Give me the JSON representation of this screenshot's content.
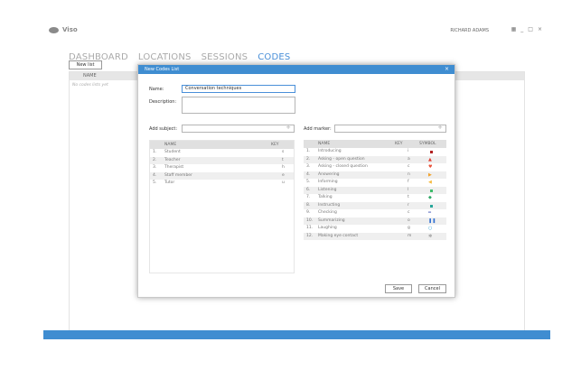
{
  "app": {
    "name": "Viso",
    "user": "RICHARD ADAMS",
    "window_controls": [
      "_",
      "□",
      "×"
    ]
  },
  "nav": {
    "tabs": [
      "DASHBOARD",
      "LOCATIONS",
      "SESSIONS",
      "CODES"
    ],
    "active": "CODES"
  },
  "toolbar": {
    "new_list": "New list"
  },
  "list": {
    "header": "NAME",
    "empty_text": "No codes lists yet"
  },
  "dialog": {
    "title": "New Codes List",
    "close": "×",
    "name_label": "Name:",
    "name_value": "Conversation techniques",
    "description_label": "Description:",
    "description_value": "",
    "add_subject_label": "Add subject:",
    "add_marker_label": "Add marker:",
    "add_symbol": "+",
    "subjects": {
      "headers": {
        "name": "NAME",
        "key": "KEY"
      },
      "rows": [
        {
          "num": "1.",
          "name": "Student",
          "key": "s"
        },
        {
          "num": "2.",
          "name": "Teacher",
          "key": "t"
        },
        {
          "num": "3.",
          "name": "Therapist",
          "key": "h"
        },
        {
          "num": "4.",
          "name": "Staff member",
          "key": "e"
        },
        {
          "num": "5.",
          "name": "Tutor",
          "key": "u"
        }
      ]
    },
    "markers": {
      "headers": {
        "name": "NAME",
        "key": "KEY",
        "symbol": "SYMBOL"
      },
      "rows": [
        {
          "num": "1.",
          "name": "Introducing",
          "key": "i",
          "symbol": "square",
          "color": "#b22222"
        },
        {
          "num": "2.",
          "name": "Asking - open question",
          "key": "a",
          "symbol": "triangle",
          "color": "#e23b2e"
        },
        {
          "num": "3.",
          "name": "Asking - closed question",
          "key": "c",
          "symbol": "heart",
          "color": "#e8533a"
        },
        {
          "num": "4.",
          "name": "Answering",
          "key": "n",
          "symbol": "arrow-right",
          "color": "#f2a22a"
        },
        {
          "num": "5.",
          "name": "Informing",
          "key": "f",
          "symbol": "arrow-left",
          "color": "#f5b93c"
        },
        {
          "num": "6.",
          "name": "Listening",
          "key": "l",
          "symbol": "square",
          "color": "#3dbb6a"
        },
        {
          "num": "7.",
          "name": "Talking",
          "key": "t",
          "symbol": "diamond",
          "color": "#2fa866"
        },
        {
          "num": "8.",
          "name": "Instructing",
          "key": "r",
          "symbol": "square",
          "color": "#26a69a"
        },
        {
          "num": "9.",
          "name": "Checking",
          "key": "c",
          "symbol": "equals",
          "color": "#3f51b5"
        },
        {
          "num": "10.",
          "name": "Summarizing",
          "key": "o",
          "symbol": "pause",
          "color": "#2f6fd1"
        },
        {
          "num": "11.",
          "name": "Laughing",
          "key": "g",
          "symbol": "circle",
          "color": "#2a9fd6"
        },
        {
          "num": "12.",
          "name": "Making eye contact",
          "key": "m",
          "symbol": "asterisk",
          "color": "#777777"
        }
      ]
    },
    "buttons": {
      "save": "Save",
      "cancel": "Cancel"
    }
  },
  "colors": {
    "accent": "#3f8dd1",
    "nav_active": "#4a90d9"
  }
}
